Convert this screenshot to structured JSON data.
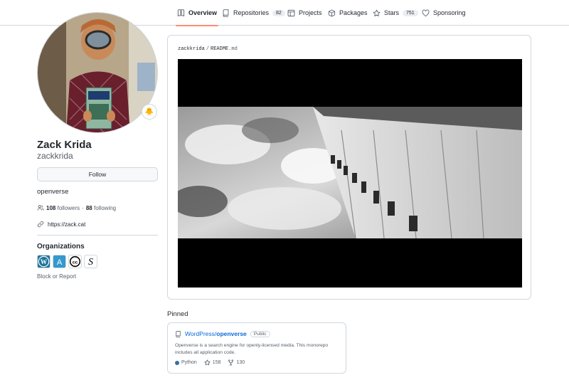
{
  "nav": {
    "tabs": [
      {
        "label": "Overview",
        "icon": "book-icon",
        "active": true
      },
      {
        "label": "Repositories",
        "icon": "repo-icon",
        "count": "82"
      },
      {
        "label": "Projects",
        "icon": "table-icon"
      },
      {
        "label": "Packages",
        "icon": "package-icon"
      },
      {
        "label": "Stars",
        "icon": "star-icon",
        "count": "751"
      },
      {
        "label": "Sponsoring",
        "icon": "heart-icon"
      }
    ]
  },
  "profile": {
    "fullname": "Zack Krida",
    "username": "zackkrida",
    "follow_label": "Follow",
    "bio": "openverse",
    "followers_count": "108",
    "followers_label": "followers",
    "following_count": "88",
    "following_label": "following",
    "dot": "·",
    "website": "https://zack.cat",
    "status_emoji": "🐥",
    "organizations_title": "Organizations",
    "organizations": [
      {
        "name": "WordPress",
        "icon": "wordpress-icon",
        "color": "#21759b"
      },
      {
        "name": "Automattic",
        "icon": "automattic-icon",
        "color": "#3499cd"
      },
      {
        "name": "Creative Commons",
        "icon": "creative-commons-icon",
        "color": "#000000"
      },
      {
        "name": "S org",
        "icon": "script-s-icon",
        "color": "#000000"
      }
    ],
    "block_report": "Block or Report"
  },
  "readme": {
    "owner": "zackkrida",
    "separator": "/",
    "file_base": "README",
    "file_ext": ".md"
  },
  "pinned": {
    "title": "Pinned",
    "items": [
      {
        "owner": "WordPress/",
        "repo": "openverse",
        "visibility": "Public",
        "description": "Openverse is a search engine for openly-licensed media. This monorepo includes all application code.",
        "language": "Python",
        "language_color": "#3572A5",
        "stars": "158",
        "forks": "130"
      }
    ]
  }
}
